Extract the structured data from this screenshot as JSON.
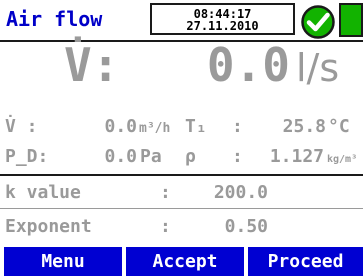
{
  "header": {
    "title": "Air flow",
    "time": "08:44:17",
    "date": "27.11.2010",
    "status_icon": "check-icon",
    "battery_icon": "battery-icon",
    "colors": {
      "title": "#0000c8",
      "ok": "#12b300",
      "button": "#0000d2"
    }
  },
  "main": {
    "label": "V̇:",
    "value": "0.0",
    "unit": "l/s"
  },
  "readings": {
    "flow_label": "V̇ :",
    "flow_value": "0.0",
    "flow_unit": "m³/h",
    "t1_label": "T₁",
    "t1_colon": ":",
    "t1_value": "25.8",
    "t1_unit": "°C",
    "pd_label": "P_D:",
    "pd_value": "0.0",
    "pd_unit": "Pa",
    "rho_label": "ρ",
    "rho_colon": ":",
    "rho_value": "1.127",
    "rho_unit": "kg/m³"
  },
  "params": {
    "k_label": "k value",
    "k_colon": ":",
    "k_value": "200.0",
    "exp_label": "Exponent",
    "exp_colon": ":",
    "exp_value": "0.50"
  },
  "buttons": {
    "menu": "Menu",
    "accept": "Accept",
    "proceed": "Proceed"
  }
}
